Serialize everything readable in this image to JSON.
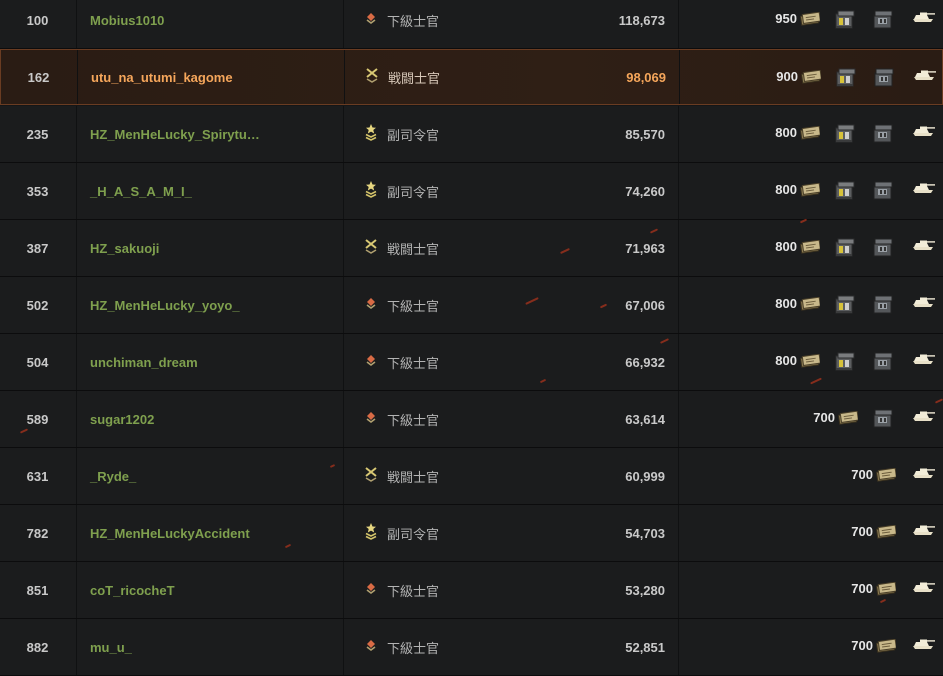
{
  "rows": [
    {
      "rank": "100",
      "name": "Mobius1010",
      "title": "下級士官",
      "rank_type": "junior",
      "score": "118,673",
      "bonds": "950",
      "crates": 2,
      "highlight": false
    },
    {
      "rank": "162",
      "name": "utu_na_utumi_kagome",
      "title": "戦闘士官",
      "rank_type": "combat",
      "score": "98,069",
      "bonds": "900",
      "crates": 2,
      "highlight": true
    },
    {
      "rank": "235",
      "name": "HZ_MenHeLucky_Spirytu…",
      "title": "副司令官",
      "rank_type": "deputy",
      "score": "85,570",
      "bonds": "800",
      "crates": 2,
      "highlight": false
    },
    {
      "rank": "353",
      "name": "_H_A_S_A_M_I_",
      "title": "副司令官",
      "rank_type": "deputy",
      "score": "74,260",
      "bonds": "800",
      "crates": 2,
      "highlight": false
    },
    {
      "rank": "387",
      "name": "HZ_sakuoji",
      "title": "戦闘士官",
      "rank_type": "combat",
      "score": "71,963",
      "bonds": "800",
      "crates": 2,
      "highlight": false
    },
    {
      "rank": "502",
      "name": "HZ_MenHeLucky_yoyo_",
      "title": "下級士官",
      "rank_type": "junior",
      "score": "67,006",
      "bonds": "800",
      "crates": 2,
      "highlight": false
    },
    {
      "rank": "504",
      "name": "unchiman_dream",
      "title": "下級士官",
      "rank_type": "junior",
      "score": "66,932",
      "bonds": "800",
      "crates": 2,
      "highlight": false
    },
    {
      "rank": "589",
      "name": "sugar1202",
      "title": "下級士官",
      "rank_type": "junior",
      "score": "63,614",
      "bonds": "700",
      "crates": 1,
      "highlight": false
    },
    {
      "rank": "631",
      "name": "_Ryde_",
      "title": "戦闘士官",
      "rank_type": "combat",
      "score": "60,999",
      "bonds": "700",
      "crates": 0,
      "highlight": false
    },
    {
      "rank": "782",
      "name": "HZ_MenHeLuckyAccident",
      "title": "副司令官",
      "rank_type": "deputy",
      "score": "54,703",
      "bonds": "700",
      "crates": 0,
      "highlight": false
    },
    {
      "rank": "851",
      "name": "coT_ricocheT",
      "title": "下級士官",
      "rank_type": "junior",
      "score": "53,280",
      "bonds": "700",
      "crates": 0,
      "highlight": false
    },
    {
      "rank": "882",
      "name": "mu_u_",
      "title": "下級士官",
      "rank_type": "junior",
      "score": "52,851",
      "bonds": "700",
      "crates": 0,
      "highlight": false
    }
  ],
  "icons": {
    "bond": "bond-icon",
    "crate": "crate-icon",
    "crate2": "crate2-icon",
    "tank": "tank-icon",
    "rank_junior": "junior-officer-rank-icon",
    "rank_combat": "combat-officer-rank-icon",
    "rank_deputy": "deputy-commander-rank-icon"
  },
  "colors": {
    "name": "#7fa04e",
    "highlight_text": "#f5a65b",
    "highlight_border": "#6a3c22",
    "row_bg": "#1b1c1d"
  }
}
